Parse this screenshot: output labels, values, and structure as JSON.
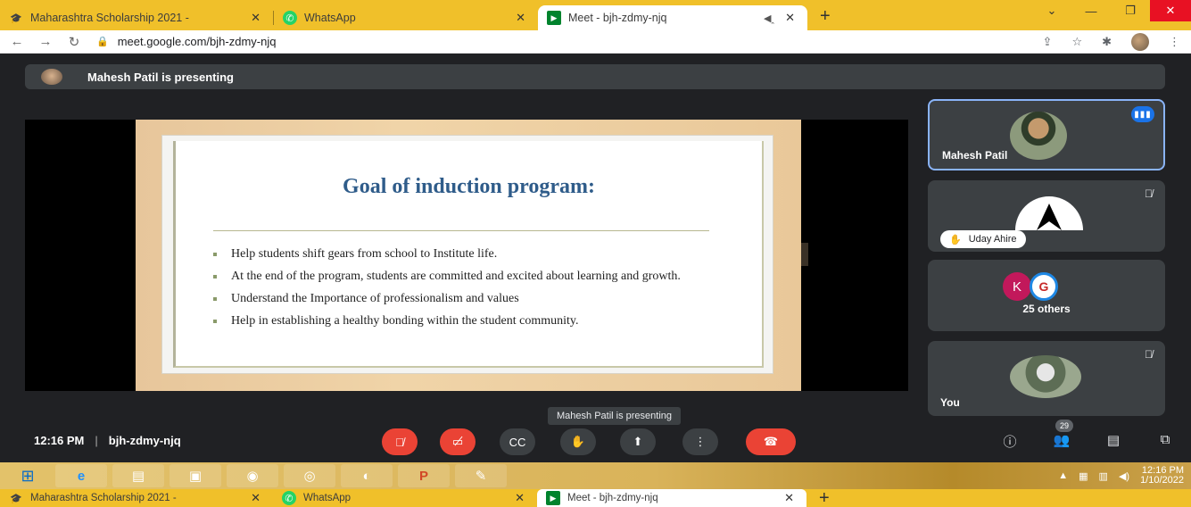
{
  "browser": {
    "tabs": [
      {
        "title": "Maharashtra Scholarship 2021 -",
        "icon": "mortarboard-icon",
        "active": false
      },
      {
        "title": "WhatsApp",
        "icon": "whatsapp-icon",
        "active": false
      },
      {
        "title": "Meet - bjh-zdmy-njq",
        "icon": "meet-icon",
        "active": true
      }
    ],
    "url": "meet.google.com/bjh-zdmy-njq",
    "accent_color": "#f0c02a"
  },
  "meet": {
    "presenting_banner": "Mahesh Patil is presenting",
    "slide": {
      "title": "Goal of induction program:",
      "bullets": [
        "Help students shift gears from school to Institute life.",
        "At the end of the program, students are committed and excited about learning and growth.",
        "Understand the Importance of professionalism and values",
        "Help in establishing a healthy bonding within the student community."
      ]
    },
    "tiles": {
      "mahesh": {
        "name": "Mahesh Patil"
      },
      "uday": {
        "name": "Uday Ahire"
      },
      "others": {
        "label": "25 others",
        "avatar_letter": "K"
      },
      "you": {
        "name": "You"
      }
    },
    "tooltip": "Mahesh Patil is presenting",
    "time": "12:16 PM",
    "meeting_code": "bjh-zdmy-njq",
    "participant_count": "29"
  },
  "taskbar": {
    "time": "12:16 PM",
    "date": "1/10/2022"
  }
}
